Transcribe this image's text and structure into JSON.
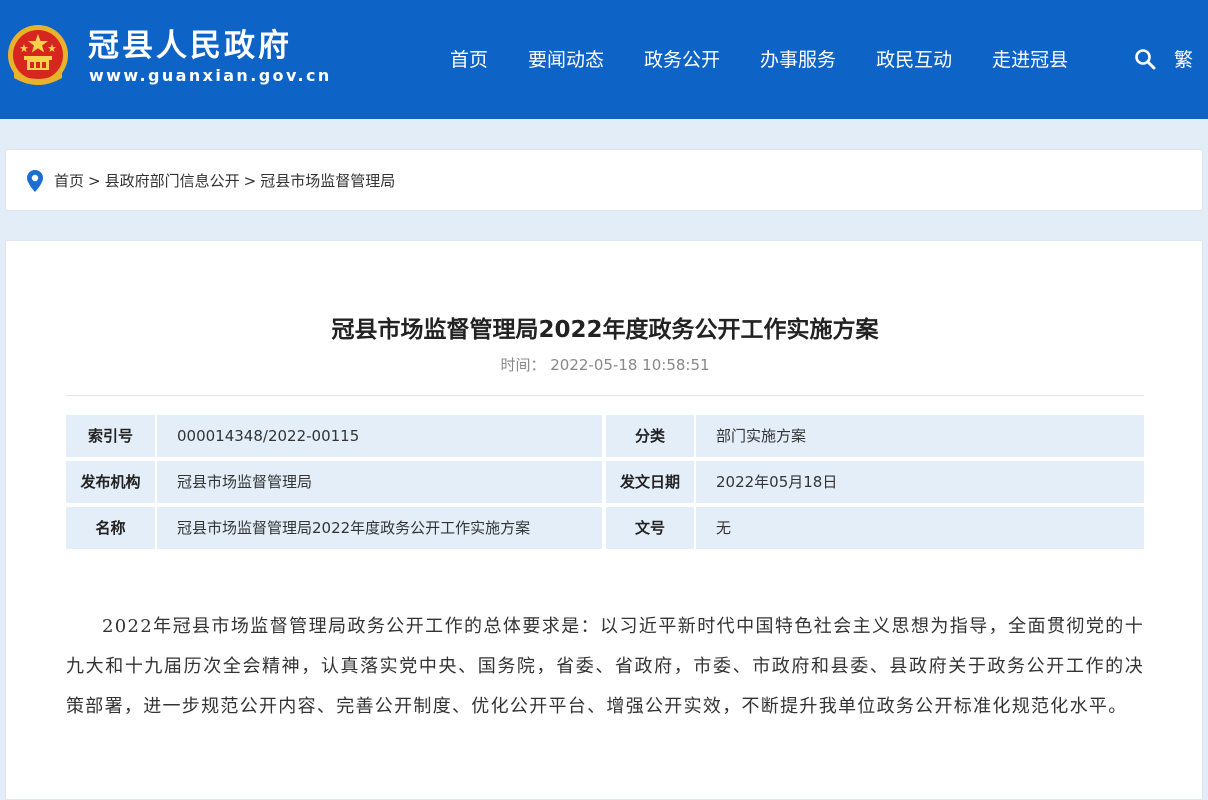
{
  "header": {
    "site_name": "冠县人民政府",
    "site_url": "www.guanxian.gov.cn",
    "nav": [
      "首页",
      "要闻动态",
      "政务公开",
      "办事服务",
      "政民互动",
      "走进冠县"
    ],
    "traditional_toggle": "繁",
    "colors": {
      "header_bg": "#0d63c6",
      "page_bg": "#e3edf8"
    }
  },
  "breadcrumb": {
    "items": [
      "首页",
      "县政府部门信息公开",
      "冠县市场监督管理局"
    ],
    "separator": ">"
  },
  "article": {
    "title": "冠县市场监督管理局2022年度政务公开工作实施方案",
    "time_label": "时间：",
    "time_value": "2022-05-18 10:58:51",
    "meta": [
      {
        "label1": "索引号",
        "value1": "000014348/2022-00115",
        "label2": "分类",
        "value2": "部门实施方案"
      },
      {
        "label1": "发布机构",
        "value1": "冠县市场监督管理局",
        "label2": "发文日期",
        "value2": "2022年05月18日"
      },
      {
        "label1": "名称",
        "value1": "冠县市场监督管理局2022年度政务公开工作实施方案",
        "label2": "文号",
        "value2": "无"
      }
    ],
    "body": "2022年冠县市场监督管理局政务公开工作的总体要求是：以习近平新时代中国特色社会主义思想为指导，全面贯彻党的十九大和十九届历次全会精神，认真落实党中央、国务院，省委、省政府，市委、市政府和县委、县政府关于政务公开工作的决策部署，进一步规范公开内容、完善公开制度、优化公开平台、增强公开实效，不断提升我单位政务公开标准化规范化水平。"
  }
}
